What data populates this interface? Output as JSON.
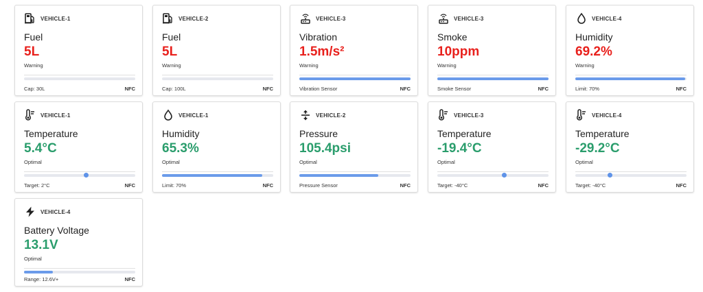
{
  "colors": {
    "warning": "#e8201c",
    "optimal": "#2a9d6c",
    "bar": "#6b9bea"
  },
  "cards": [
    {
      "icon": "fuel-pump-icon",
      "vehicle": "VEHICLE-1",
      "metric": "Fuel",
      "value": "5L",
      "status": "Warning",
      "status_type": "warning",
      "indicator": "bar",
      "level_percent": 0,
      "footer_left": "Cap: 30L",
      "footer_right": "NFC"
    },
    {
      "icon": "fuel-pump-icon",
      "vehicle": "VEHICLE-2",
      "metric": "Fuel",
      "value": "5L",
      "status": "Warning",
      "status_type": "warning",
      "indicator": "bar",
      "level_percent": 0,
      "footer_left": "Cap: 100L",
      "footer_right": "NFC"
    },
    {
      "icon": "sensor-icon",
      "vehicle": "VEHICLE-3",
      "metric": "Vibration",
      "value": "1.5m/s²",
      "status": "Warning",
      "status_type": "warning",
      "indicator": "bar",
      "level_percent": 100,
      "footer_left": "Vibration Sensor",
      "footer_right": "NFC"
    },
    {
      "icon": "sensor-icon",
      "vehicle": "VEHICLE-3",
      "metric": "Smoke",
      "value": "10ppm",
      "status": "Warning",
      "status_type": "warning",
      "indicator": "bar",
      "level_percent": 100,
      "footer_left": "Smoke Sensor",
      "footer_right": "NFC"
    },
    {
      "icon": "water-drop-icon",
      "vehicle": "VEHICLE-4",
      "metric": "Humidity",
      "value": "69.2%",
      "status": "Warning",
      "status_type": "warning",
      "indicator": "bar",
      "level_percent": 99,
      "footer_left": "Limit: 70%",
      "footer_right": "NFC"
    },
    {
      "icon": "thermometer-icon",
      "vehicle": "VEHICLE-1",
      "metric": "Temperature",
      "value": "5.4°C",
      "status": "Optimal",
      "status_type": "optimal",
      "indicator": "dot",
      "level_percent": 56,
      "footer_left": "Target: 2°C",
      "footer_right": "NFC"
    },
    {
      "icon": "water-drop-icon",
      "vehicle": "VEHICLE-1",
      "metric": "Humidity",
      "value": "65.3%",
      "status": "Optimal",
      "status_type": "optimal",
      "indicator": "bar",
      "level_percent": 90,
      "footer_left": "Limit: 70%",
      "footer_right": "NFC"
    },
    {
      "icon": "pressure-icon",
      "vehicle": "VEHICLE-2",
      "metric": "Pressure",
      "value": "105.4psi",
      "status": "Optimal",
      "status_type": "optimal",
      "indicator": "bar",
      "level_percent": 71,
      "footer_left": "Pressure Sensor",
      "footer_right": "NFC"
    },
    {
      "icon": "thermometer-icon",
      "vehicle": "VEHICLE-3",
      "metric": "Temperature",
      "value": "-19.4°C",
      "status": "Optimal",
      "status_type": "optimal",
      "indicator": "dot",
      "level_percent": 60,
      "footer_left": "Target: -40°C",
      "footer_right": "NFC"
    },
    {
      "icon": "thermometer-icon",
      "vehicle": "VEHICLE-4",
      "metric": "Temperature",
      "value": "-29.2°C",
      "status": "Optimal",
      "status_type": "optimal",
      "indicator": "dot",
      "level_percent": 31,
      "footer_left": "Target: -40°C",
      "footer_right": "NFC"
    },
    {
      "icon": "lightning-bolt-icon",
      "vehicle": "VEHICLE-4",
      "metric": "Battery Voltage",
      "value": "13.1V",
      "status": "Optimal",
      "status_type": "optimal",
      "indicator": "bar",
      "level_percent": 26,
      "footer_left": "Range: 12.6V+",
      "footer_right": "NFC"
    }
  ]
}
